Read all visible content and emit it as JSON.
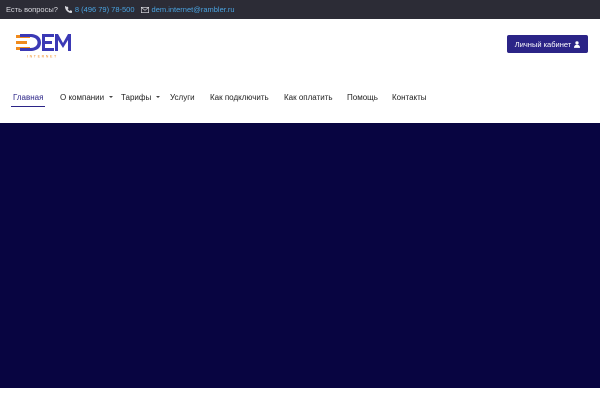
{
  "topbar": {
    "question": "Есть вопросы?",
    "phone": "8 (496 79) 78-500",
    "email": "dem.internet@rambler.ru",
    "phone_icon": "phone-icon",
    "email_icon": "envelope-icon"
  },
  "logo": {
    "text": "DEM",
    "subtext": "INTERNET"
  },
  "cabinet_button": {
    "label": "Личный кабинет",
    "icon": "user-icon"
  },
  "nav": {
    "items": [
      {
        "label": "Главная",
        "active": true
      },
      {
        "label": "О компании",
        "dropdown": true
      },
      {
        "label": "Тарифы",
        "dropdown": true
      },
      {
        "label": "Услуги"
      },
      {
        "label": "Как подключить"
      },
      {
        "label": "Как оплатить"
      },
      {
        "label": "Помощь"
      },
      {
        "label": "Контакты"
      }
    ]
  },
  "colors": {
    "topbar_bg": "#2c2c36",
    "accent": "#2b2487",
    "hero_bg": "#080541",
    "link": "#4aa3e0"
  }
}
